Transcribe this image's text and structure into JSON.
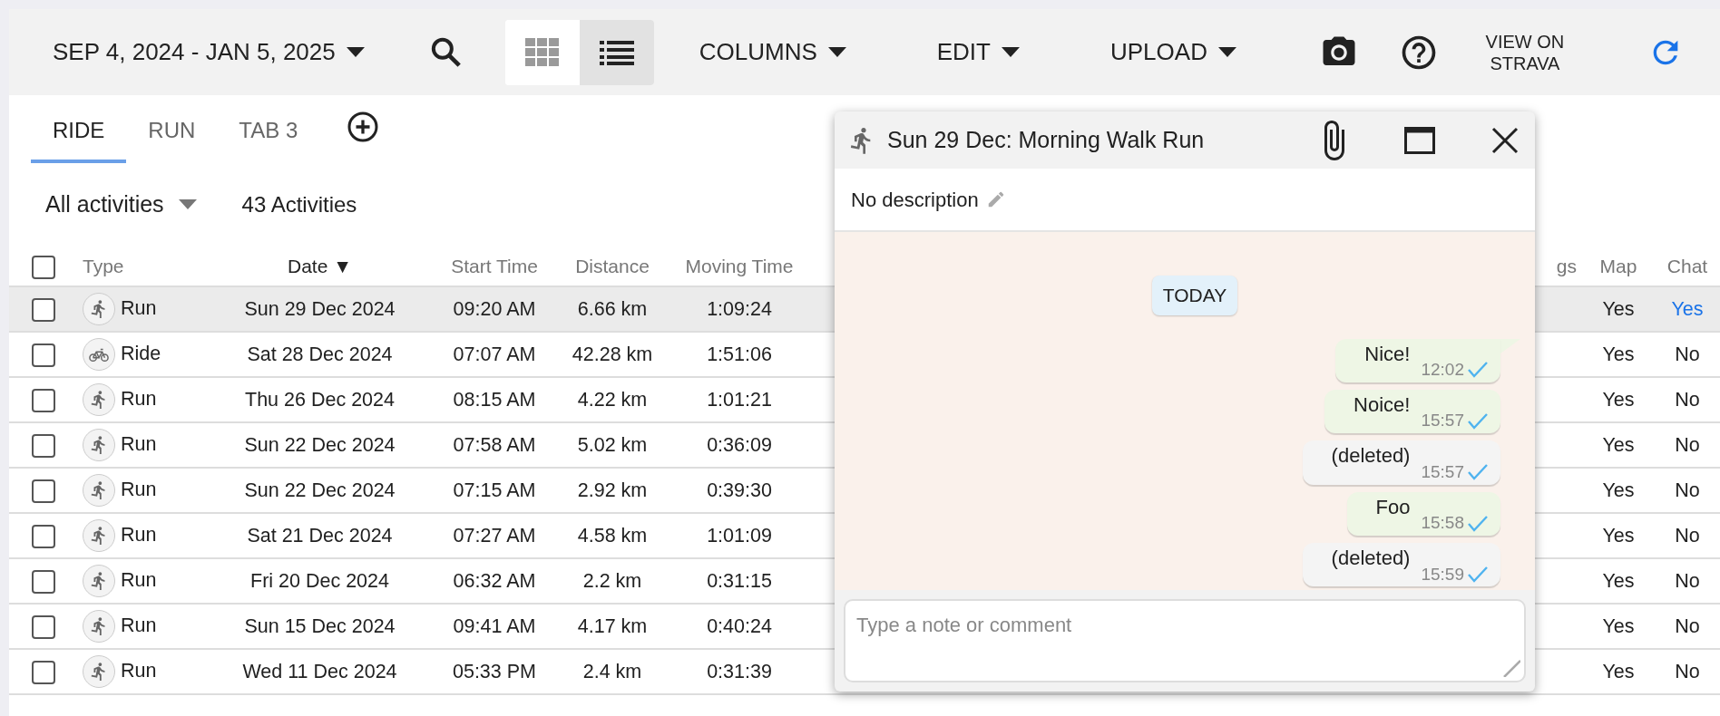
{
  "toolbar": {
    "date_range": "SEP 4, 2024 - JAN 5, 2025",
    "view_modes": [
      {
        "kind": "grid",
        "selected": false
      },
      {
        "kind": "list",
        "selected": true
      }
    ],
    "menus": [
      "COLUMNS",
      "EDIT",
      "UPLOAD"
    ],
    "strava_link": "VIEW ON STRAVA"
  },
  "tabs": [
    {
      "label": "RIDE",
      "selected": true
    },
    {
      "label": "RUN",
      "selected": false
    },
    {
      "label": "TAB 3",
      "selected": false
    }
  ],
  "filter": {
    "label": "All activities",
    "count": "43 Activities"
  },
  "table": {
    "all_checked": false,
    "columns": [
      {
        "kind": "type",
        "label": "Type",
        "sorted": false
      },
      {
        "kind": "date",
        "label": "Date",
        "sorted": true,
        "sort_indicator": "▼"
      },
      {
        "kind": "start",
        "label": "Start Time",
        "sorted": false
      },
      {
        "kind": "distance",
        "label": "Distance",
        "sorted": false
      },
      {
        "kind": "moving",
        "label": "Moving Time",
        "sorted": false
      },
      {
        "kind": "hidden",
        "label": "gs",
        "sorted": false
      },
      {
        "kind": "map",
        "label": "Map",
        "sorted": false
      },
      {
        "kind": "chat",
        "label": "Chat",
        "sorted": false
      }
    ],
    "rows": [
      {
        "checked": false,
        "selected": true,
        "kind": "run",
        "type_label": "Run",
        "date": "Sun 29 Dec 2024",
        "start": "09:20 AM",
        "distance": "6.66 km",
        "moving": "1:09:24",
        "map": "Yes",
        "chat": "Yes",
        "chat_link": true
      },
      {
        "checked": false,
        "selected": false,
        "kind": "ride",
        "type_label": "Ride",
        "date": "Sat 28 Dec 2024",
        "start": "07:07 AM",
        "distance": "42.28 km",
        "moving": "1:51:06",
        "map": "Yes",
        "chat": "No",
        "chat_link": false
      },
      {
        "checked": false,
        "selected": false,
        "kind": "run",
        "type_label": "Run",
        "date": "Thu 26 Dec 2024",
        "start": "08:15 AM",
        "distance": "4.22 km",
        "moving": "1:01:21",
        "map": "Yes",
        "chat": "No",
        "chat_link": false
      },
      {
        "checked": false,
        "selected": false,
        "kind": "run",
        "type_label": "Run",
        "date": "Sun 22 Dec 2024",
        "start": "07:58 AM",
        "distance": "5.02 km",
        "moving": "0:36:09",
        "map": "Yes",
        "chat": "No",
        "chat_link": false
      },
      {
        "checked": false,
        "selected": false,
        "kind": "run",
        "type_label": "Run",
        "date": "Sun 22 Dec 2024",
        "start": "07:15 AM",
        "distance": "2.92 km",
        "moving": "0:39:30",
        "map": "Yes",
        "chat": "No",
        "chat_link": false
      },
      {
        "checked": false,
        "selected": false,
        "kind": "run",
        "type_label": "Run",
        "date": "Sat 21 Dec 2024",
        "start": "07:27 AM",
        "distance": "4.58 km",
        "moving": "1:01:09",
        "map": "Yes",
        "chat": "No",
        "chat_link": false
      },
      {
        "checked": false,
        "selected": false,
        "kind": "run",
        "type_label": "Run",
        "date": "Fri 20 Dec 2024",
        "start": "06:32 AM",
        "distance": "2.2 km",
        "moving": "0:31:15",
        "map": "Yes",
        "chat": "No",
        "chat_link": false
      },
      {
        "checked": false,
        "selected": false,
        "kind": "run",
        "type_label": "Run",
        "date": "Sun 15 Dec 2024",
        "start": "09:41 AM",
        "distance": "4.17 km",
        "moving": "0:40:24",
        "map": "Yes",
        "chat": "No",
        "chat_link": false
      },
      {
        "checked": false,
        "selected": false,
        "kind": "run",
        "type_label": "Run",
        "date": "Wed 11 Dec 2024",
        "start": "05:33 PM",
        "distance": "2.4 km",
        "moving": "0:31:39",
        "map": "Yes",
        "chat": "No",
        "chat_link": false
      }
    ]
  },
  "chat": {
    "title": "Sun 29 Dec: Morning Walk Run",
    "description": "No description",
    "day": "TODAY",
    "messages": [
      {
        "kind": "text",
        "text": "Nice!",
        "time": "12:02",
        "tail": true
      },
      {
        "kind": "text",
        "text": "Noice!",
        "time": "15:57",
        "tail": false
      },
      {
        "kind": "deleted",
        "text": "(deleted)",
        "time": "15:57",
        "tail": false
      },
      {
        "kind": "text",
        "text": "Foo",
        "time": "15:58",
        "tail": false
      },
      {
        "kind": "deleted",
        "text": "(deleted)",
        "time": "15:59",
        "tail": false
      }
    ],
    "placeholder": "Type a note or comment"
  }
}
